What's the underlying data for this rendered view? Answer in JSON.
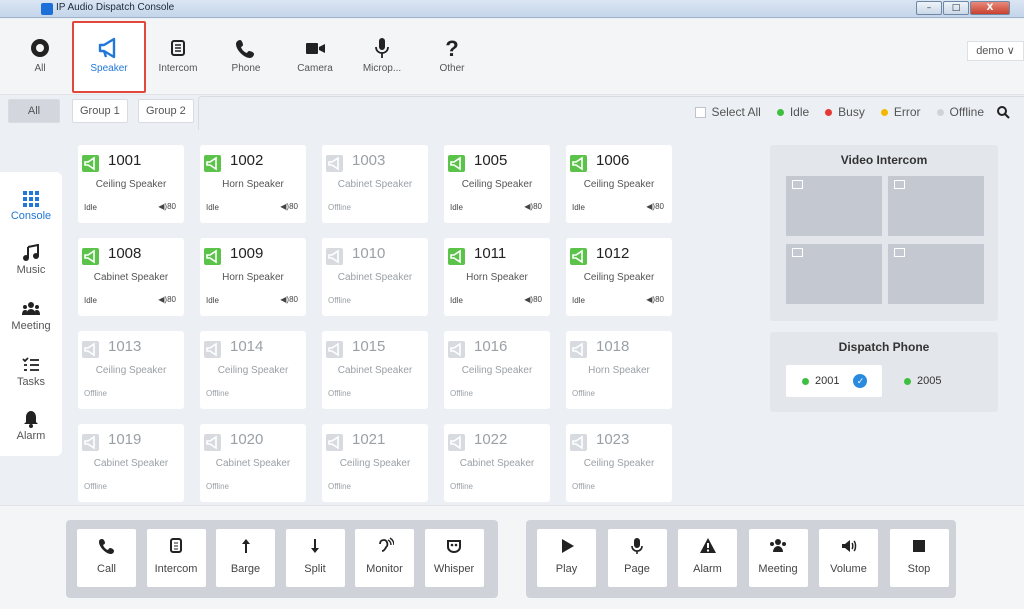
{
  "window": {
    "title": "IP Audio Dispatch Console",
    "btn_min": "–",
    "btn_max": "□",
    "btn_close": "X"
  },
  "categories": [
    {
      "id": "all",
      "label": "All"
    },
    {
      "id": "speaker",
      "label": "Speaker"
    },
    {
      "id": "intercom",
      "label": "Intercom"
    },
    {
      "id": "phone",
      "label": "Phone"
    },
    {
      "id": "camera",
      "label": "Camera"
    },
    {
      "id": "microphone",
      "label": "Microp..."
    },
    {
      "id": "other",
      "label": "Other"
    }
  ],
  "active_category": "Speaker",
  "user_menu": {
    "label": "demo ∨"
  },
  "groups": [
    "All",
    "Group 1",
    "Group 2"
  ],
  "filters": {
    "select_all": "Select All",
    "idle": "Idle",
    "busy": "Busy",
    "error": "Error",
    "offline": "Offline"
  },
  "sidebar": [
    "Console",
    "Music",
    "Meeting",
    "Tasks",
    "Alarm"
  ],
  "cards": [
    {
      "num": "1001",
      "type": "Ceiling Speaker",
      "status": "Idle",
      "vol": "◀)80"
    },
    {
      "num": "1002",
      "type": "Horn Speaker",
      "status": "Idle",
      "vol": "◀)80"
    },
    {
      "num": "1003",
      "type": "Cabinet Speaker",
      "status": "Offline",
      "vol": ""
    },
    {
      "num": "1005",
      "type": "Ceiling Speaker",
      "status": "Idle",
      "vol": "◀)80"
    },
    {
      "num": "1006",
      "type": "Ceiling Speaker",
      "status": "Idle",
      "vol": "◀)80"
    },
    {
      "num": "1008",
      "type": "Cabinet Speaker",
      "status": "Idle",
      "vol": "◀)80"
    },
    {
      "num": "1009",
      "type": "Horn Speaker",
      "status": "Idle",
      "vol": "◀)80"
    },
    {
      "num": "1010",
      "type": "Cabinet Speaker",
      "status": "Offline",
      "vol": ""
    },
    {
      "num": "1011",
      "type": "Horn Speaker",
      "status": "Idle",
      "vol": "◀)80"
    },
    {
      "num": "1012",
      "type": "Ceiling Speaker",
      "status": "Idle",
      "vol": "◀)80"
    },
    {
      "num": "1013",
      "type": "Ceiling Speaker",
      "status": "Offline",
      "vol": ""
    },
    {
      "num": "1014",
      "type": "Ceiling Speaker",
      "status": "Offline",
      "vol": ""
    },
    {
      "num": "1015",
      "type": "Cabinet Speaker",
      "status": "Offline",
      "vol": ""
    },
    {
      "num": "1016",
      "type": "Ceiling Speaker",
      "status": "Offline",
      "vol": ""
    },
    {
      "num": "1018",
      "type": "Horn Speaker",
      "status": "Offline",
      "vol": ""
    },
    {
      "num": "1019",
      "type": "Cabinet Speaker",
      "status": "Offline",
      "vol": ""
    },
    {
      "num": "1020",
      "type": "Cabinet Speaker",
      "status": "Offline",
      "vol": ""
    },
    {
      "num": "1021",
      "type": "Ceiling Speaker",
      "status": "Offline",
      "vol": ""
    },
    {
      "num": "1022",
      "type": "Cabinet Speaker",
      "status": "Offline",
      "vol": ""
    },
    {
      "num": "1023",
      "type": "Ceiling Speaker",
      "status": "Offline",
      "vol": ""
    }
  ],
  "video_intercom": {
    "title": "Video Intercom"
  },
  "dispatch_phone": {
    "title": "Dispatch Phone",
    "lines": [
      {
        "num": "2001",
        "selected": true
      },
      {
        "num": "2005",
        "selected": false
      }
    ]
  },
  "call_actions": [
    "Call",
    "Intercom",
    "Barge",
    "Split",
    "Monitor",
    "Whisper"
  ],
  "broadcast_actions": [
    "Play",
    "Page",
    "Alarm",
    "Meeting",
    "Volume",
    "Stop"
  ],
  "colors": {
    "accent": "#2278d8",
    "idle": "#3fbf3f",
    "busy": "#e53935",
    "error": "#f5b800",
    "offline": "#d0d4d9",
    "active_border": "#e2473b",
    "speaker_online": "#5cc34a",
    "speaker_offline": "#d7dbe0"
  }
}
